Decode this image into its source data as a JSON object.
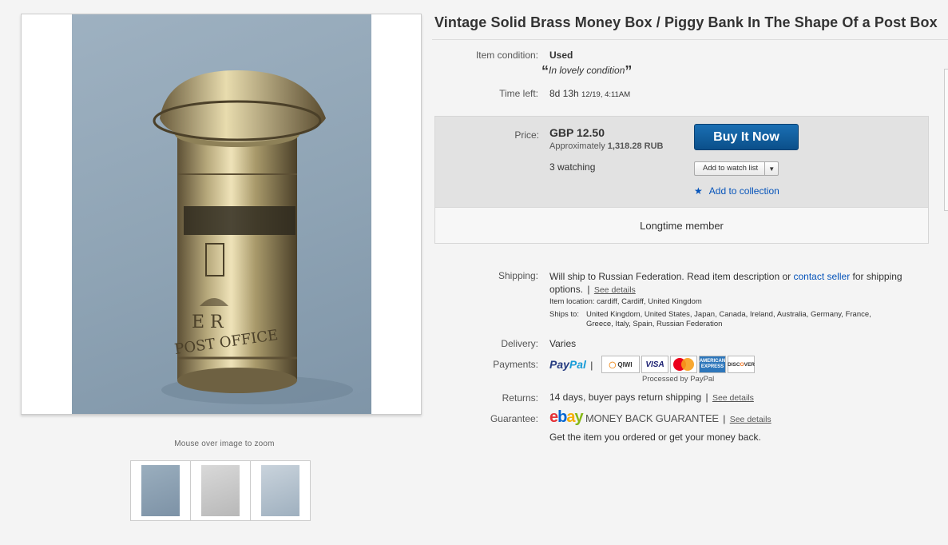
{
  "listing": {
    "title": "Vintage Solid Brass Money Box / Piggy Bank In The Shape Of a Post Box"
  },
  "gallery": {
    "zoom_hint": "Mouse over image to zoom",
    "thumbnails": [
      "thumbnail-1",
      "thumbnail-2",
      "thumbnail-3"
    ]
  },
  "condition": {
    "label": "Item condition:",
    "value": "Used",
    "open_quote": "“",
    "note": "In lovely condition",
    "close_quote": "”"
  },
  "time_left": {
    "label": "Time left:",
    "value": "8d 13h",
    "end": "12/19, 4:11AM"
  },
  "price": {
    "label": "Price:",
    "value": "GBP 12.50",
    "approx_prefix": "Approximately",
    "approx_value": "1,318.28 RUB",
    "watching": "3 watching",
    "buy_now": "Buy It Now",
    "watch_list": "Add to watch list",
    "collection": "Add to collection",
    "member": "Longtime member"
  },
  "shipping": {
    "label": "Shipping:",
    "text_before": "Will ship to Russian Federation. Read item description or",
    "contact_link": "contact seller",
    "text_after": "for shipping options.",
    "see_details": "See details",
    "location_label": "Item location:",
    "location": "cardiff, Cardiff, United Kingdom",
    "ships_to_label": "Ships to:",
    "ships_to_line1": "United Kingdom, United States, Japan, Canada, Ireland, Australia, Germany, France,",
    "ships_to_line2": "Greece, Italy, Spain, Russian Federation"
  },
  "delivery": {
    "label": "Delivery:",
    "value": "Varies"
  },
  "payments": {
    "label": "Payments:",
    "paypal_pay": "Pay",
    "paypal_pal": "Pal",
    "separator": "|",
    "qiwi": "QIWI",
    "visa": "VISA",
    "amex": "AMERICAN EXPRESS",
    "discover_pre": "DISC",
    "discover_o": "O",
    "discover_post": "VER",
    "processed": "Processed by PayPal"
  },
  "returns": {
    "label": "Returns:",
    "value": "14 days, buyer pays return shipping",
    "separator": "|",
    "see_details": "See details"
  },
  "guarantee": {
    "label": "Guarantee:",
    "ebay_e": "e",
    "ebay_b": "b",
    "ebay_a": "a",
    "ebay_y": "y",
    "mbg": "MONEY BACK GUARANTEE",
    "separator": "|",
    "see_details": "See details",
    "note": "Get the item you ordered or get your money back."
  },
  "photo_text": {
    "cipher": "E R",
    "post_office": "POST OFFICE"
  }
}
